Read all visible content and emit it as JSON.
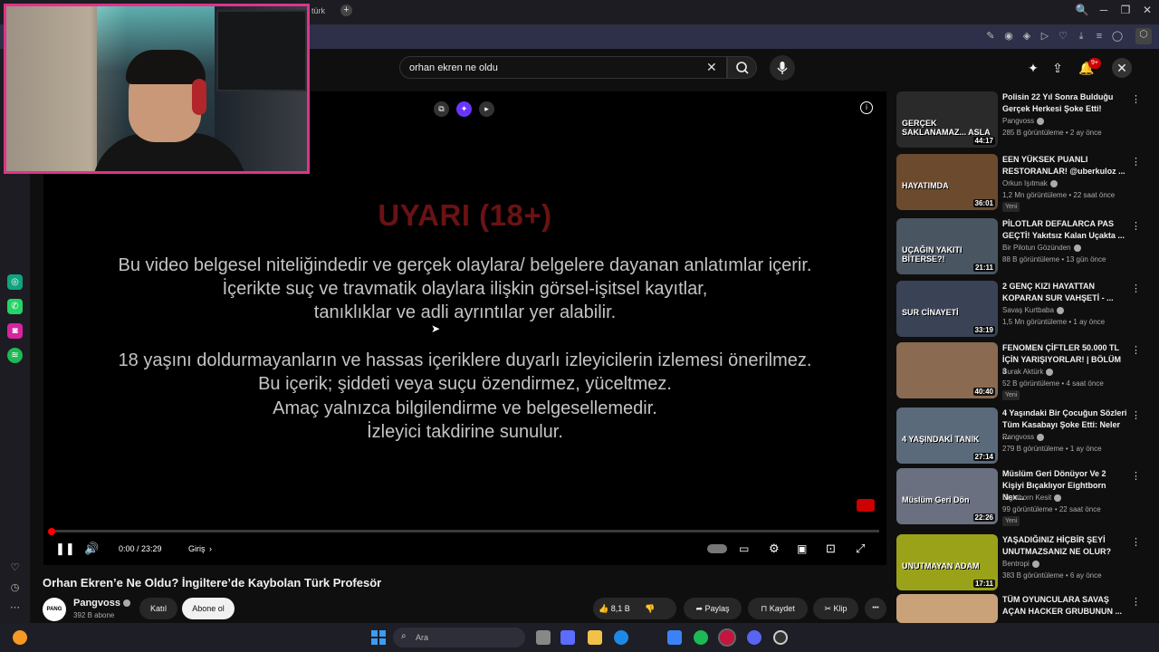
{
  "browser": {
    "tab_fragment": "türk",
    "new_tab": "+",
    "window_controls": [
      "🔍",
      "─",
      "❐",
      "✕"
    ]
  },
  "youtube": {
    "search": {
      "query": "orhan ekren ne oldu",
      "clear_glyph": "✕",
      "search_glyph": "🔍",
      "mic_glyph": "🎙"
    },
    "notifications_badge": "9+"
  },
  "player": {
    "warning_title": "UYARI (18+)",
    "warning_lines": [
      "Bu video belgesel niteliğindedir ve gerçek olaylara/ belgelere dayanan anlatımlar içerir.",
      "İçerikte suç ve travmatik olaylara ilişkin görsel-işitsel kayıtlar,",
      "tanıklıklar ve adli ayrıntılar yer alabilir.",
      "18 yaşını doldurmayanların ve hassas içeriklere duyarlı izleyicilerin izlemesi önerilmez.",
      "Bu içerik; şiddeti veya suçu özendirmez, yüceltmez.",
      "Amaç yalnızca bilgilendirme ve belgesellemedir.",
      "İzleyici takdirine sunulur."
    ],
    "time": "0:00 / 23:29",
    "chapter": "Giriş",
    "progress_fraction": 0.006
  },
  "video": {
    "title": "Orhan Ekren’e Ne Oldu? İngiltere’de Kaybolan Türk Profesör",
    "channel": {
      "name": "Pangvoss",
      "subs": "392 B abone",
      "avatar_text": "PANG VOSS"
    },
    "join_label": "Katıl",
    "subscribe_label": "Abone ol",
    "likes": "8,1 B",
    "share_label": "Paylaş",
    "save_label": "Kaydet",
    "clip_label": "Klip",
    "more_glyph": "•••"
  },
  "recommendations": [
    {
      "title": "Polisin 22 Yıl Sonra Bulduğu Gerçek Herkesi Şoke Etti!",
      "channel": "Pangvoss",
      "meta": "285 B görüntüleme • 2 ay önce",
      "duration": "44:17",
      "overlay": "GERÇEK SAKLANAMAZ... ASLA",
      "new": "",
      "color": "#2a2a2a"
    },
    {
      "title": "EEN YÜKSEK PUANLI RESTORANLAR! @uberkuloz ...",
      "channel": "Orkun Işıtmak",
      "meta": "1,2 Mn görüntüleme • 22 saat önce",
      "duration": "36:01",
      "overlay": "HAYATIMDA",
      "new": "Yeni",
      "color": "#6b4a2e"
    },
    {
      "title": "PİLOTLAR DEFALARCA PAS GEÇTİ! Yakıtsız Kalan Uçakta ...",
      "channel": "Bir Pilotun Gözünden",
      "meta": "88 B görüntüleme • 13 gün önce",
      "duration": "21:11",
      "overlay": "UÇAĞIN YAKITI BİTERSE?!",
      "new": "",
      "color": "#4a5562"
    },
    {
      "title": "2 GENÇ KIZI HAYATTAN KOPARAN SUR VAHŞETİ - ...",
      "channel": "Savaş Kurtbaba",
      "meta": "1,5 Mn görüntüleme • 1 ay önce",
      "duration": "33:19",
      "overlay": "SUR CİNAYETİ",
      "new": "",
      "color": "#3a4356"
    },
    {
      "title": "FENOMEN ÇİFTLER 50.000 TL İÇİN YARIŞIYORLAR! | BÖLÜM 3",
      "channel": "Burak Aktürk",
      "meta": "52 B görüntüleme • 4 saat önce",
      "duration": "40:40",
      "overlay": "",
      "new": "Yeni",
      "color": "#8a6a50"
    },
    {
      "title": "4 Yaşındaki Bir Çocuğun Sözleri Tüm Kasabayı Şoke Etti: Neler ...",
      "channel": "Pangvoss",
      "meta": "279 B görüntüleme • 1 ay önce",
      "duration": "27:14",
      "overlay": "4 YAŞINDAKİ TANIK",
      "new": "",
      "color": "#5a6a7a"
    },
    {
      "title": "Müslüm Geri Dönüyor Ve 2 Kişiyi Bıçaklıyor Eightborn Nex...",
      "channel": "Eightborn Kesit",
      "meta": "99 görüntüleme • 22 saat önce",
      "duration": "22:26",
      "overlay": "Müslüm Geri Dön",
      "new": "Yeni",
      "color": "#6a7080"
    },
    {
      "title": "YAŞADIĞINIZ HİÇBİR ŞEYİ UNUTMAZSANIZ NE OLUR?",
      "channel": "Bentropi",
      "meta": "383 B görüntüleme • 6 ay önce",
      "duration": "17:11",
      "overlay": "UNUTMAYAN ADAM",
      "new": "",
      "color": "#9aa21a"
    },
    {
      "title": "TÜM OYUNCULARA SAVAŞ AÇAN HACKER GRUBUNUN ...",
      "channel": "",
      "meta": "",
      "duration": "",
      "overlay": "",
      "new": "",
      "color": "#c9a27a"
    }
  ],
  "taskbar": {
    "search_placeholder": "Ara"
  }
}
